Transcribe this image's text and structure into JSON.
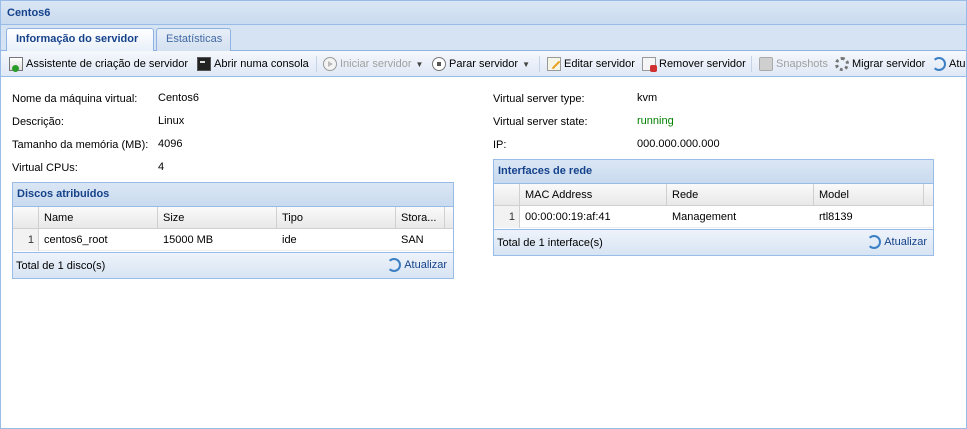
{
  "window": {
    "title": "Centos6"
  },
  "tabs": [
    {
      "label": "Informação do servidor",
      "active": true
    },
    {
      "label": "Estatísticas",
      "active": false
    }
  ],
  "toolbar": {
    "wizard": "Assistente de criação de servidor",
    "console": "Abrir numa consola",
    "start": "Iniciar servidor",
    "stop": "Parar servidor",
    "edit": "Editar servidor",
    "remove": "Remover servidor",
    "snapshots": "Snapshots",
    "migrate": "Migrar servidor",
    "refresh": "Atu"
  },
  "left_props": [
    {
      "label": "Nome da máquina virtual:",
      "value": "Centos6"
    },
    {
      "label": "Descrição:",
      "value": "Linux"
    },
    {
      "label": "Tamanho da memória (MB):",
      "value": "4096"
    },
    {
      "label": "Virtual CPUs:",
      "value": "4"
    }
  ],
  "right_props": [
    {
      "label": "Virtual server type:",
      "value": "kvm"
    },
    {
      "label": "Virtual server state:",
      "value": "running"
    },
    {
      "label": "IP:",
      "value": "000.000.000.000"
    }
  ],
  "disks": {
    "title": "Discos atribuídos",
    "columns": [
      "Name",
      "Size",
      "Tipo",
      "Stora..."
    ],
    "rows": [
      {
        "num": "1",
        "name": "centos6_root",
        "size": "15000 MB",
        "tipo": "ide",
        "storage": "SAN"
      }
    ],
    "total": "Total de 1 disco(s)",
    "refresh": "Atualizar"
  },
  "interfaces": {
    "title": "Interfaces de rede",
    "columns": [
      "MAC Address",
      "Rede",
      "Model"
    ],
    "rows": [
      {
        "num": "1",
        "mac": "00:00:00:19:af:41",
        "rede": "Management",
        "model": "rtl8139"
      }
    ],
    "total": "Total de 1 interface(s)",
    "refresh": "Atualizar"
  },
  "colors": {
    "state_running": "#008000",
    "header_text": "#15428b",
    "border": "#99bbe8"
  }
}
